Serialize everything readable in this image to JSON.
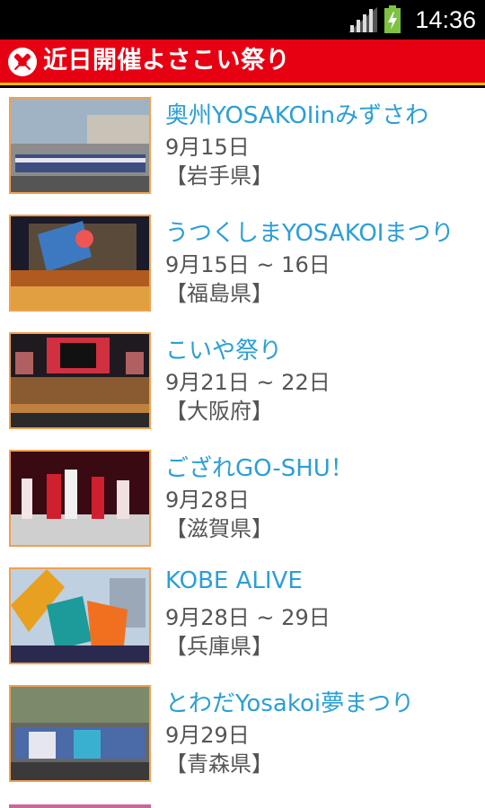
{
  "status_bar": {
    "time": "14:36",
    "signal_icon": "signal-icon",
    "battery_icon": "battery-charging-icon"
  },
  "header": {
    "title": "近日開催よさこい祭り",
    "logo_icon": "naruko-clapper-icon",
    "bg_color": "#e60012",
    "accent_color": "#f2c400"
  },
  "events": [
    {
      "title": "奥州YOSAKOIinみずさわ",
      "date": "9月15日",
      "prefecture": "【岩手県】"
    },
    {
      "title": "うつくしまYOSAKOIまつり",
      "date": "9月15日 ~ 16日",
      "prefecture": "【福島県】"
    },
    {
      "title": "こいや祭り",
      "date": "9月21日 ~ 22日",
      "prefecture": "【大阪府】"
    },
    {
      "title": "ござれGO-SHU！",
      "date": "9月28日",
      "prefecture": "【滋賀県】"
    },
    {
      "title": "KOBE ALIVE",
      "date": "9月28日 ~ 29日",
      "prefecture": "【兵庫県】"
    },
    {
      "title": "とわだYosakoi夢まつり",
      "date": "9月29日",
      "prefecture": "【青森県】"
    }
  ],
  "colors": {
    "title_text": "#2a9fd6",
    "detail_text": "#555555",
    "thumb_border": "#f0a050"
  }
}
